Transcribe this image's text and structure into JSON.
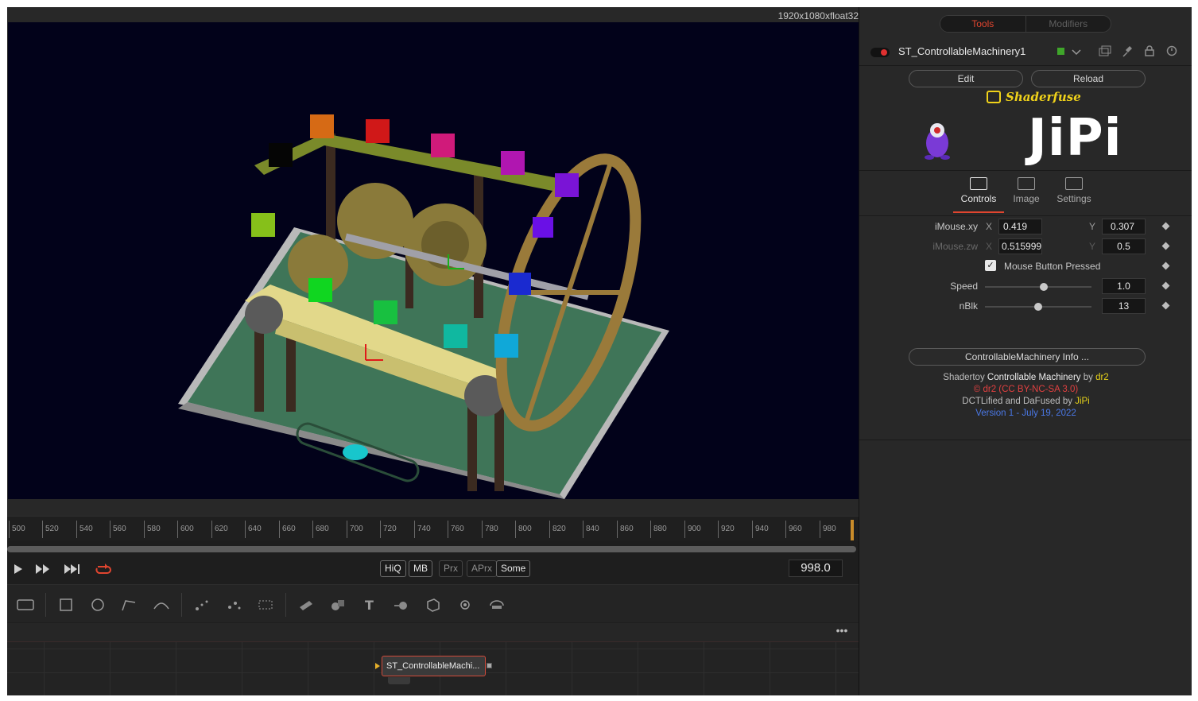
{
  "viewer": {
    "resolution": "1920x1080xfloat32"
  },
  "timeline": {
    "ticks": [
      "500",
      "520",
      "540",
      "560",
      "580",
      "600",
      "620",
      "640",
      "660",
      "680",
      "700",
      "720",
      "740",
      "760",
      "780",
      "800",
      "820",
      "840",
      "860",
      "880",
      "900",
      "920",
      "940",
      "960",
      "980"
    ]
  },
  "transport": {
    "quality_buttons": [
      "HiQ",
      "MB",
      "Prx",
      "APrx",
      "Some"
    ],
    "current_frame": "998.0"
  },
  "node_view": {
    "menu_label": "•••",
    "node_label": "ST_ControllableMachi..."
  },
  "inspector": {
    "tabs": [
      "Tools",
      "Modifiers"
    ],
    "tool_name": "ST_ControllableMachinery1",
    "edit_label": "Edit",
    "reload_label": "Reload",
    "brand": "Shaderfuse",
    "logo_text": "JiPi",
    "panel_tabs": [
      "Controls",
      "Image",
      "Settings"
    ],
    "controls": {
      "imouse_xy": {
        "label": "iMouse.xy",
        "x_label": "X",
        "x": "0.419",
        "y_label": "Y",
        "y": "0.307"
      },
      "imouse_zw": {
        "label": "iMouse.zw",
        "x_label": "X",
        "x": "0.515999",
        "y_label": "Y",
        "y": "0.5"
      },
      "mouse_button": {
        "label": "Mouse Button Pressed",
        "checked": true
      },
      "speed": {
        "label": "Speed",
        "value": "1.0",
        "fraction": 0.55
      },
      "nblk": {
        "label": "nBlk",
        "value": "13",
        "fraction": 0.5
      }
    },
    "info_button": "ControllableMachinery Info ...",
    "credits": {
      "line1_a": "Shadertoy ",
      "line1_b": "Controllable Machinery",
      "line1_c": " by ",
      "line1_d": "dr2",
      "line2": "© dr2 (CC BY-NC-SA 3.0)",
      "line3_a": "DCTLified and DaFused by ",
      "line3_b": "JiPi",
      "line4": "Version 1 - July 19, 2022"
    }
  },
  "colors": {
    "accent": "#e0452f",
    "brand_yellow": "#f0d21a",
    "version_blue": "#4a78e6"
  }
}
